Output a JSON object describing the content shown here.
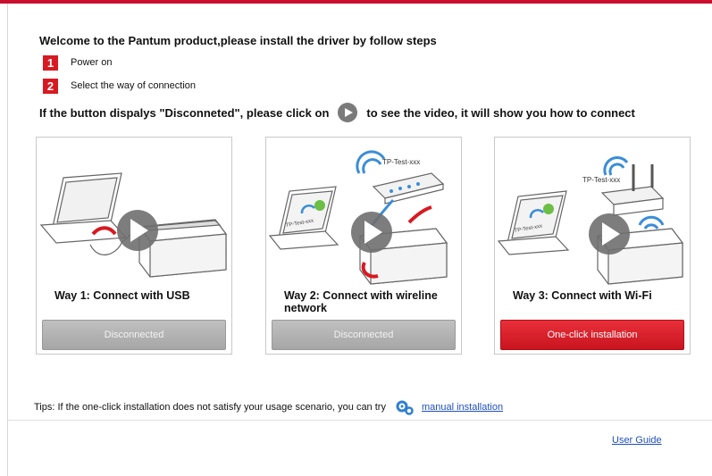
{
  "welcome": "Welcome to the Pantum product,please install the driver by follow steps",
  "steps": [
    {
      "num": "1",
      "label": "Power on"
    },
    {
      "num": "2",
      "label": "Select the way of connection"
    }
  ],
  "hint": {
    "before": "If the button dispalys \"Disconneted\", please click on",
    "after": "to see the video, it will show you how to connect"
  },
  "cards": [
    {
      "title": "Way 1: Connect with USB",
      "button": "Disconnected",
      "state": "disconnected"
    },
    {
      "title": "Way 2: Connect with wireline network",
      "button": "Disconnected",
      "state": "disconnected",
      "router_label": "TP-Test-xxx",
      "laptop_label": "TP-Test-xxx"
    },
    {
      "title": "Way 3: Connect with Wi-Fi",
      "button": "One-click installation",
      "state": "active",
      "router_label": "TP-Test-xxx",
      "laptop_label": "TP-Test-xxx"
    }
  ],
  "tips": {
    "text": "Tips: If the one-click installation does not satisfy your usage scenario, you can try",
    "link": "manual installation",
    "icon": "gear-icon"
  },
  "footer": {
    "user_guide": "User Guide"
  },
  "colors": {
    "brand_red": "#d71a21",
    "gray_button": "#b3b3b3",
    "link": "#1f4fbf"
  }
}
